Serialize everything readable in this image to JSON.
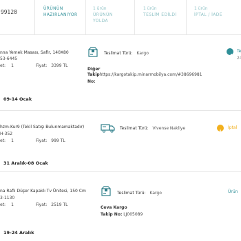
{
  "order_no": "99128",
  "tabs": [
    {
      "count": "",
      "label": "ÜRÜNÜN HAZIRLANIYOR",
      "label1": "ÜRÜNÜN",
      "label2": "HAZIRLANIYOR",
      "state": "active"
    },
    {
      "count": "1 ürün",
      "label1": "ÜRÜNÜN",
      "label2": "YOLDA",
      "state": "inactive"
    },
    {
      "count": "1 ürün",
      "label1": "TESLİM EDİLDİ",
      "label2": "",
      "state": "inactive"
    },
    {
      "count": "1 ürün",
      "label1": "İPTAL / İADE",
      "label2": "",
      "state": "inactive"
    }
  ],
  "items": [
    {
      "name": "nna Yemek Masası, Safir, 140X80",
      "code": "53-6445",
      "qty_label": "et:",
      "qty": "1",
      "price_label": "Fiyat:",
      "price": "3399 TL",
      "delivery_type_label": "Teslimat Türü:",
      "delivery_type": "Kargo",
      "carrier": "Diğer",
      "tracking_label1": "Takip",
      "tracking_label2": "No:",
      "tracking_value": "https://kargotakip.minarmobilya.com/#38696981",
      "date_range": "09-14 Ocak",
      "status_text": "Te",
      "status_sub": "24",
      "status_color": "#2f8f98"
    },
    {
      "name": "hzm-Kur9 (Tekil Satışı Bulunmamaktadır)",
      "code": "H-352",
      "qty_label": "et:",
      "qty": "1",
      "price_label": "Fiyat:",
      "price": "999 TL",
      "delivery_type_label": "Teslimat Türü:",
      "delivery_type": "Vivense Nakliye",
      "date_range": "31 Aralık-08 Ocak",
      "status_text": "İptal",
      "status_color": "#f2b01e"
    },
    {
      "name": "na Raflı Düşer Kapaklı Tv Ünitesi, 150 Cm",
      "code": "3-1130",
      "qty_label": "et:",
      "qty": "1",
      "price_label": "Fiyat:",
      "price": "2519 TL",
      "delivery_type_label": "Teslimat Türü:",
      "delivery_type": "Kargo",
      "carrier": "Ceva Kargo",
      "tracking_label": "Takip No:",
      "tracking_value": "LJ005089",
      "date_range": "19-24 Aralık",
      "status_text": "Ürün",
      "status_color": "#2f8f98"
    }
  ]
}
